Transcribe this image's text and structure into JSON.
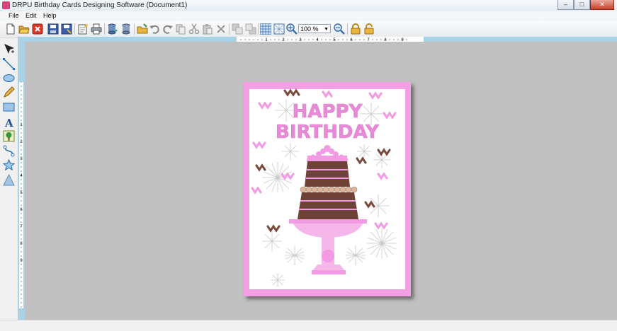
{
  "window": {
    "title": "DRPU Birthday Cards Designing Software  (Document1)",
    "buttons": {
      "minimize": "–",
      "maximize": "□",
      "close": "✕"
    }
  },
  "menu": [
    "File",
    "Edit",
    "Help"
  ],
  "toolbar": {
    "zoom": "100 %",
    "icons": [
      "new-icon",
      "open-icon",
      "close-icon",
      "save-icon",
      "save-as-icon",
      "properties-icon",
      "print-icon",
      "export-icon",
      "database-icon",
      "folder-icon",
      "undo-icon",
      "redo-icon",
      "copy-icon",
      "cut-icon",
      "paste-icon",
      "delete-icon",
      "bring-front-icon",
      "send-back-icon",
      "grid-icon",
      "show-grid-icon",
      "zoom-in-icon",
      "zoom-out-icon",
      "lock-icon",
      "unlock-icon"
    ]
  },
  "tools": [
    "select-tool-icon",
    "line-tool-icon",
    "ellipse-tool-icon",
    "pencil-tool-icon",
    "rectangle-tool-icon",
    "text-tool-icon",
    "image-tool-icon",
    "curve-tool-icon",
    "star-tool-icon",
    "triangle-tool-icon"
  ],
  "rulers": {
    "horizontal_ticks": [
      "1",
      "2",
      "3",
      "4",
      "5",
      "6",
      "7",
      "8",
      "9"
    ],
    "vertical_ticks": [
      "1",
      "2",
      "3",
      "4",
      "5",
      "6",
      "7",
      "8",
      "9"
    ]
  },
  "card": {
    "line1": "HAPPY",
    "line2": "BIRTHDAY"
  },
  "colors": {
    "card_border": "#f29fe3",
    "card_text": "#e98ad8",
    "cake_brown": "#6e4236",
    "ribbon_brown": "#7a4b3c",
    "ribbon_pink": "#f39ae4",
    "canvas_bg": "#c0c0c0",
    "ruler_blue": "#a9d2e6"
  }
}
